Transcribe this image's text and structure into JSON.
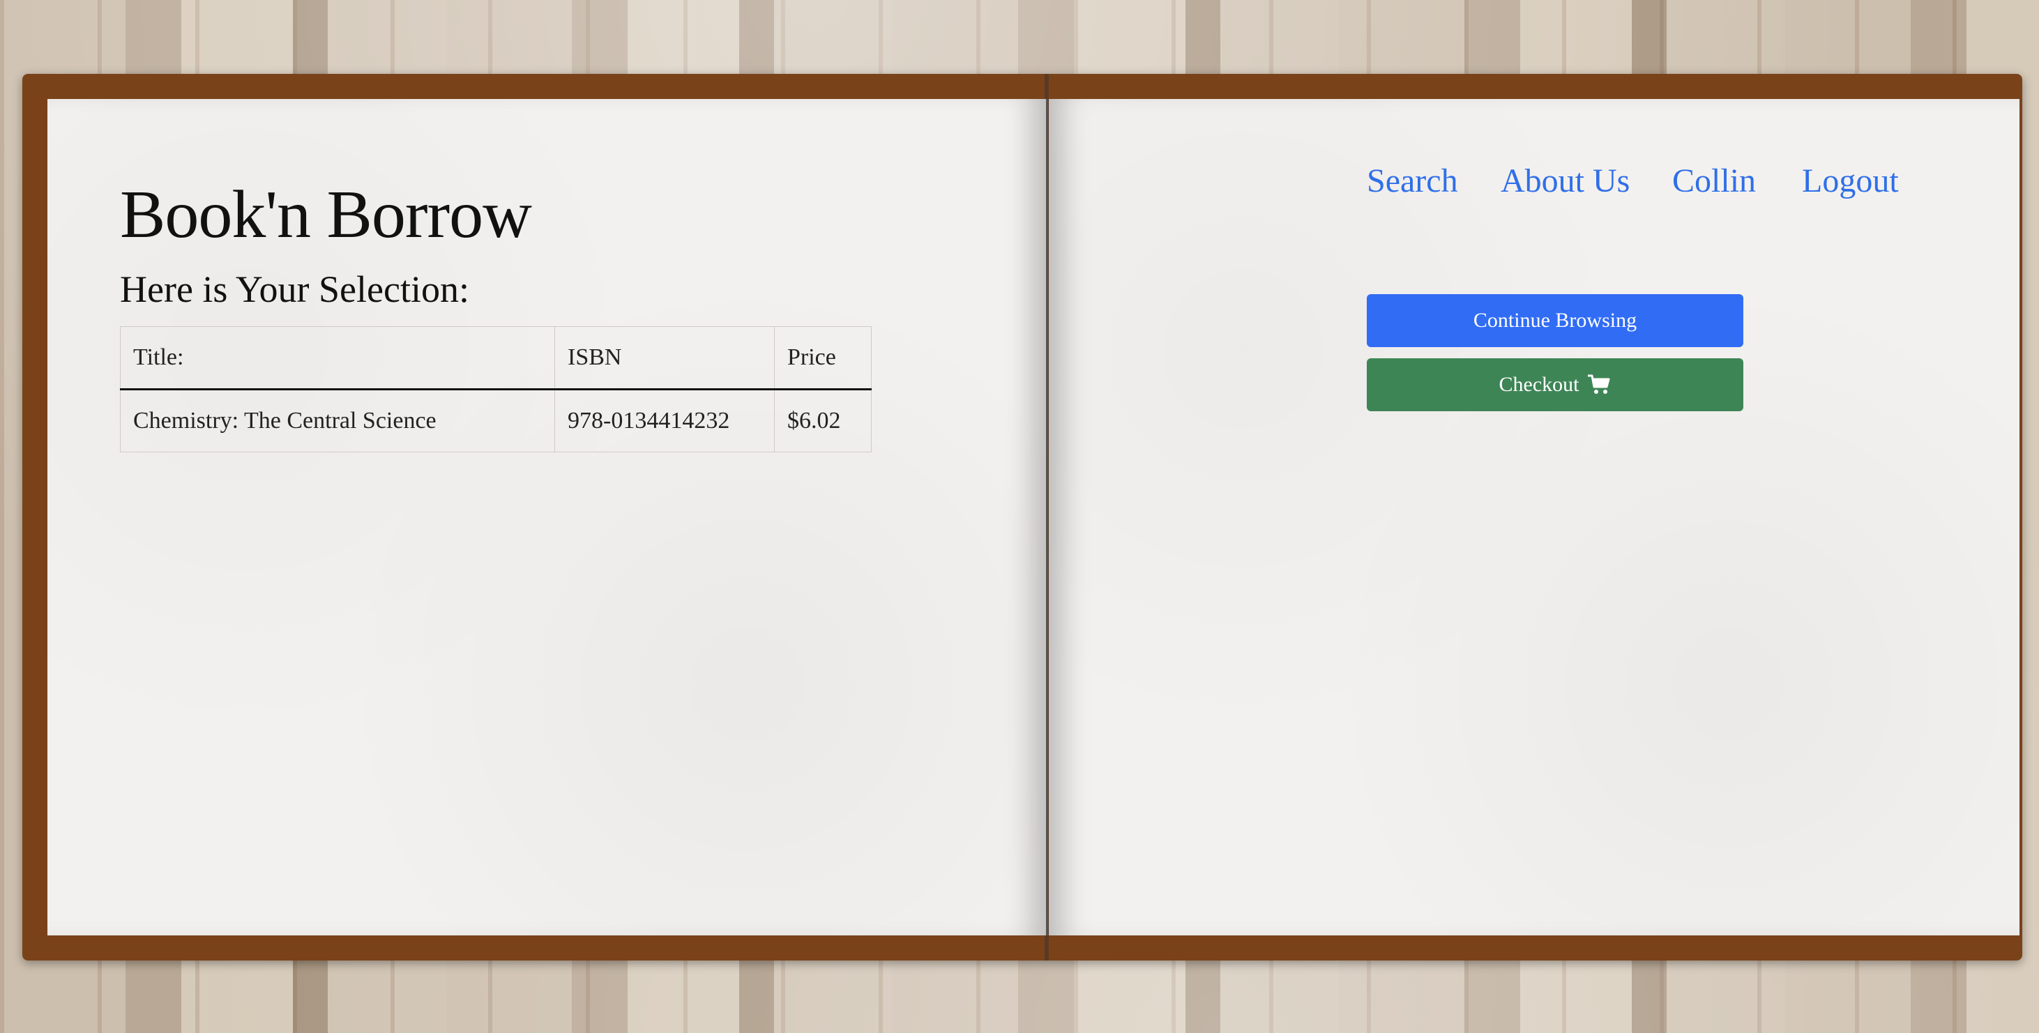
{
  "site": {
    "title": "Book'n Borrow"
  },
  "nav": {
    "search": "Search",
    "about": "About Us",
    "user": "Collin",
    "logout": "Logout"
  },
  "selection": {
    "heading": "Here is Your Selection:",
    "columns": [
      "Title:",
      "ISBN",
      "Price"
    ],
    "rows": [
      {
        "title": "Chemistry: The Central Science",
        "isbn": "978-0134414232",
        "price": "$6.02"
      }
    ]
  },
  "actions": {
    "continue_label": "Continue Browsing",
    "checkout_label": "Checkout",
    "checkout_icon": "shopping-cart-icon"
  },
  "colors": {
    "link": "#2f6fe8",
    "primary_button": "#316cf4",
    "success_button": "#3e8556",
    "book_cover": "#7a4219"
  }
}
